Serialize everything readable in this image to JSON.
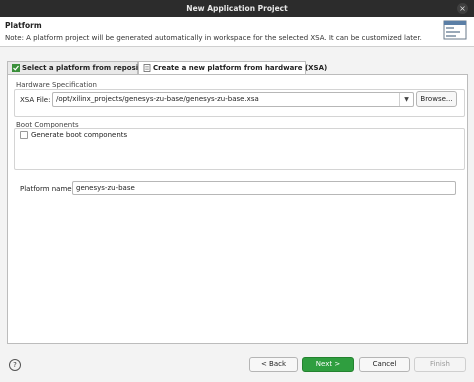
{
  "window": {
    "title": "New Application Project",
    "close_glyph": "×"
  },
  "header": {
    "title": "Platform",
    "note": "Note: A platform project will be generated automatically in workspace for the selected XSA. It can be customized later.",
    "icon": "wizard-window-icon"
  },
  "tabs": [
    {
      "label": "Select a platform from repository",
      "active": false,
      "icon": "checkmark-icon"
    },
    {
      "label": "Create a new platform from hardware (XSA)",
      "active": true,
      "icon": "document-icon"
    }
  ],
  "hardware": {
    "group_label": "Hardware Specification",
    "xsa_label": "XSA File:",
    "xsa_value": "/opt/xilinx_projects/genesys-zu-base/genesys-zu-base.xsa",
    "browse_label": "Browse..."
  },
  "boot": {
    "group_label": "Boot Components",
    "checkbox_label": "Generate boot components",
    "checked": false
  },
  "platform_name": {
    "label": "Platform name:",
    "value": "genesys-zu-base"
  },
  "footer": {
    "help_glyph": "?",
    "back_label": "< Back",
    "next_label": "Next >",
    "cancel_label": "Cancel",
    "finish_label": "Finish"
  },
  "colors": {
    "primary": "#2f9e3f",
    "titlebar": "#2c2c2c"
  }
}
